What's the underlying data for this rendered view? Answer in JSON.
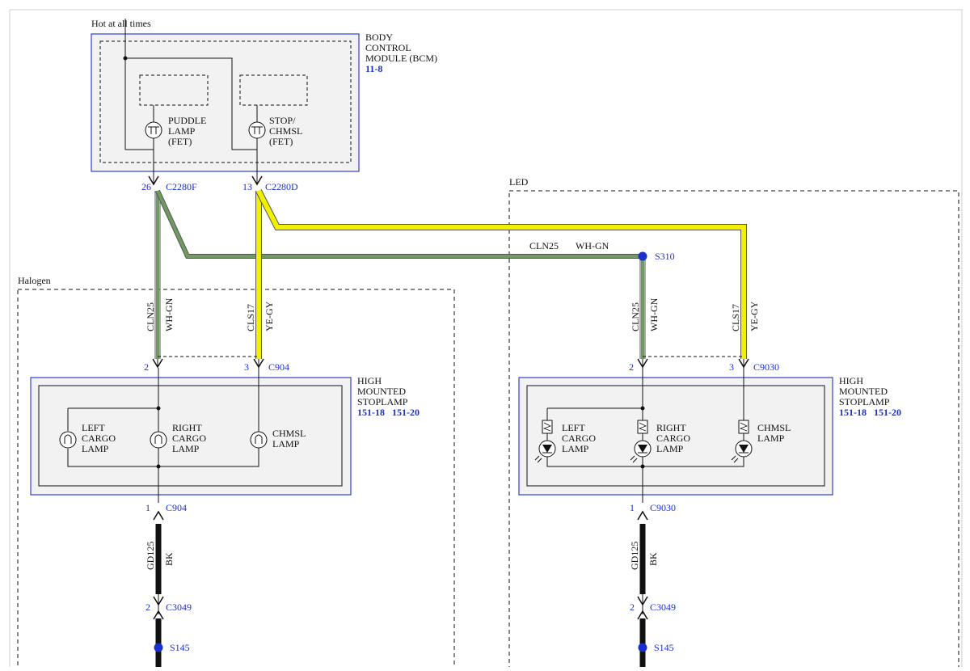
{
  "power": {
    "hot_label": "Hot at all times"
  },
  "bcm": {
    "title_lines": [
      "BODY",
      "CONTROL",
      "MODULE (BCM)"
    ],
    "ref": "11-8",
    "puddle_lines": [
      "PUDDLE",
      "LAMP",
      "(FET)"
    ],
    "stop_lines": [
      "STOP/",
      "CHMSL",
      "(FET)"
    ],
    "pin_puddle": "26",
    "conn_puddle": "C2280F",
    "pin_stop": "13",
    "conn_stop": "C2280D"
  },
  "sections": {
    "halogen": "Halogen",
    "led": "LED"
  },
  "wires": {
    "cln25_circuit": "CLN25",
    "cln25_color": "WH-GN",
    "cls17_circuit": "CLS17",
    "cls17_color": "YE-GY",
    "gd125_circuit": "GD125",
    "gd125_color": "BK"
  },
  "splices": {
    "s310": "S310",
    "s145": "S145"
  },
  "halogen_module": {
    "title_lines": [
      "HIGH",
      "MOUNTED",
      "STOPLAMP"
    ],
    "ref1": "151-18",
    "ref2": "151-20",
    "pin2": "2",
    "pin3": "3",
    "conn_top": "C904",
    "pin1": "1",
    "conn_bottom": "C904",
    "left_lamp": [
      "LEFT",
      "CARGO",
      "LAMP"
    ],
    "right_lamp": [
      "RIGHT",
      "CARGO",
      "LAMP"
    ],
    "chmsl_lamp": [
      "CHMSL",
      "LAMP"
    ]
  },
  "led_module": {
    "title_lines": [
      "HIGH",
      "MOUNTED",
      "STOPLAMP"
    ],
    "ref1": "151-18",
    "ref2": "151-20",
    "pin2": "2",
    "pin3": "3",
    "conn_top": "C9030",
    "pin1": "1",
    "conn_bottom": "C9030",
    "left_lamp": [
      "LEFT",
      "CARGO",
      "LAMP"
    ],
    "right_lamp": [
      "RIGHT",
      "CARGO",
      "LAMP"
    ],
    "chmsl_lamp": [
      "CHMSL",
      "LAMP"
    ]
  },
  "ground": {
    "pin": "2",
    "conn": "C3049"
  },
  "colors": {
    "wire_green": "#6f9a62",
    "wire_yellow": "#f0f000",
    "wire_outline": "#555555",
    "link_blue": "#1a2fd0",
    "module_fill": "#f2f2f2",
    "module_border": "#3040d0"
  }
}
